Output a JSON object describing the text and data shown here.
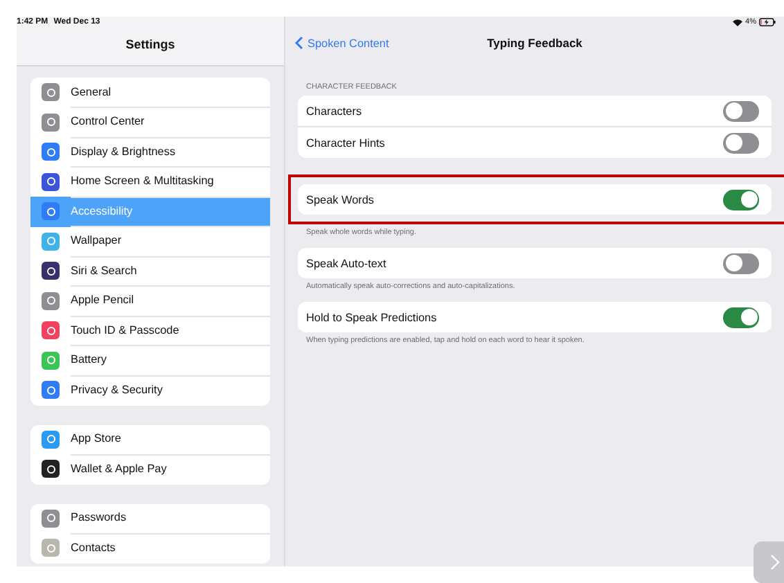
{
  "status_bar": {
    "time": "1:42 PM",
    "date": "Wed Dec 13",
    "battery": "4%"
  },
  "sidebar": {
    "title": "Settings",
    "groups": [
      {
        "items": [
          {
            "label": "General",
            "color": "#8e8e93",
            "selected": false
          },
          {
            "label": "Control Center",
            "color": "#8e8e93",
            "selected": false
          },
          {
            "label": "Display & Brightness",
            "color": "#2f7cf6",
            "selected": false
          },
          {
            "label": "Home Screen & Multitasking",
            "color": "#3a55d8",
            "selected": false
          },
          {
            "label": "Accessibility",
            "color": "#2f7cf6",
            "selected": true
          },
          {
            "label": "Wallpaper",
            "color": "#3fb3e8",
            "selected": false
          },
          {
            "label": "Siri & Search",
            "color": "#3b2f6b",
            "selected": false
          },
          {
            "label": "Apple Pencil",
            "color": "#8e8e93",
            "selected": false
          },
          {
            "label": "Touch ID & Passcode",
            "color": "#f2405f",
            "selected": false
          },
          {
            "label": "Battery",
            "color": "#3ac45a",
            "selected": false
          },
          {
            "label": "Privacy & Security",
            "color": "#2f7cf6",
            "selected": false
          }
        ]
      },
      {
        "items": [
          {
            "label": "App Store",
            "color": "#2a9af3",
            "selected": false
          },
          {
            "label": "Wallet & Apple Pay",
            "color": "#222222",
            "selected": false
          }
        ]
      },
      {
        "items": [
          {
            "label": "Passwords",
            "color": "#8e8e93",
            "selected": false
          },
          {
            "label": "Contacts",
            "color": "#b9b6ad",
            "selected": false
          }
        ]
      }
    ]
  },
  "detail": {
    "back": "Spoken Content",
    "title": "Typing Feedback",
    "sections": [
      {
        "header": "CHARACTER FEEDBACK",
        "highlighted": false,
        "rows": [
          {
            "label": "Characters",
            "on": false
          },
          {
            "label": "Character Hints",
            "on": false
          }
        ]
      },
      {
        "highlighted": true,
        "rows": [
          {
            "label": "Speak Words",
            "on": true
          }
        ],
        "footer": "Speak whole words while typing."
      },
      {
        "highlighted": false,
        "rows": [
          {
            "label": "Speak Auto-text",
            "on": false
          }
        ],
        "footer": "Automatically speak auto-corrections and auto-capitalizations."
      },
      {
        "highlighted": false,
        "rows": [
          {
            "label": "Hold to Speak Predictions",
            "on": true
          }
        ],
        "footer": "When typing predictions are enabled, tap and hold on each word to hear it spoken."
      }
    ]
  }
}
